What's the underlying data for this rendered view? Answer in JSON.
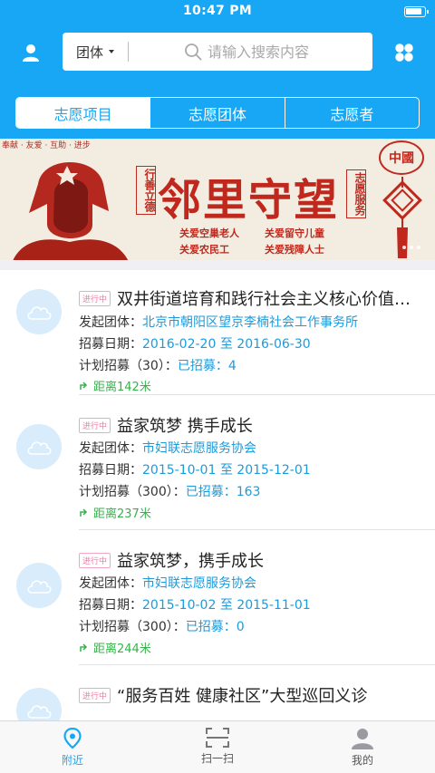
{
  "status_bar": {
    "time": "10:47 PM"
  },
  "header": {
    "user_icon": "user-icon",
    "grid_icon": "grid-icon",
    "search": {
      "scope_label": "团体",
      "placeholder": "请输入搜索内容",
      "value": ""
    },
    "segments": [
      {
        "label": "志愿项目",
        "active": true
      },
      {
        "label": "志愿团体",
        "active": false
      },
      {
        "label": "志愿者",
        "active": false
      }
    ]
  },
  "banner": {
    "topline": "奉献 · 友爱 · 互助 · 进步",
    "left_vertical": "行善立德",
    "title": "邻里守望",
    "right_vertical": "志愿服务",
    "slogans": [
      "关爱空巢老人",
      "关爱留守儿童",
      "关爱农民工",
      "关爱残障人士"
    ],
    "emblem": "中國",
    "dot_count": 3
  },
  "list": {
    "field_labels": {
      "organizer": "发起团体：",
      "dates": "招募日期：",
      "plan_prefix": "计划招募",
      "recruited": "已招募："
    },
    "items": [
      {
        "status": "进行中",
        "title": "双井街道培育和践行社会主义核心价值观志愿服务",
        "organizer": "北京市朝阳区望京李楠社会工作事务所",
        "date_start": "2016-02-20",
        "date_sep": "至",
        "date_end": "2016-06-30",
        "plan": "（30）：",
        "recruited": "4",
        "distance": "距离142米"
      },
      {
        "status": "进行中",
        "title": "益家筑梦 携手成长",
        "organizer": "市妇联志愿服务协会",
        "date_start": "2015-10-01",
        "date_sep": "至",
        "date_end": "2015-12-01",
        "plan": "（300）：",
        "recruited": "163",
        "distance": "距离237米"
      },
      {
        "status": "进行中",
        "title": "益家筑梦，携手成长",
        "organizer": "市妇联志愿服务协会",
        "date_start": "2015-10-02",
        "date_sep": "至",
        "date_end": "2015-11-01",
        "plan": "（300）：",
        "recruited": "0",
        "distance": "距离244米"
      },
      {
        "status": "进行中",
        "title": "“服务百姓 健康社区”大型巡回义诊",
        "organizer": "",
        "date_start": "",
        "date_sep": "",
        "date_end": "",
        "plan": "",
        "recruited": "",
        "distance": ""
      }
    ]
  },
  "bottom_nav": [
    {
      "label": "附近",
      "icon": "location-pin-icon",
      "active": true
    },
    {
      "label": "扫一扫",
      "icon": "scan-icon",
      "active": false
    },
    {
      "label": "我的",
      "icon": "profile-icon",
      "active": false
    }
  ],
  "colors": {
    "brand_blue": "#17a7f5",
    "link_blue": "#1c9bdc",
    "distance_green": "#35b34a",
    "badge_pink": "#ee7aa6",
    "banner_red": "#c0281e"
  }
}
